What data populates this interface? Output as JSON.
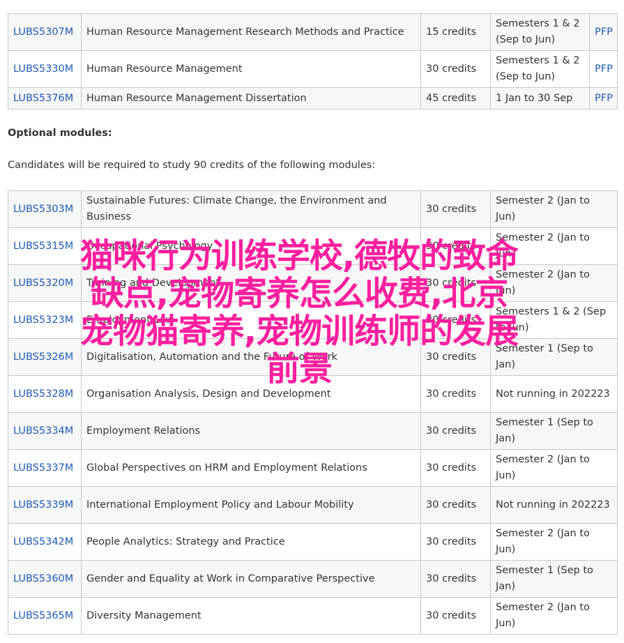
{
  "core_modules": [
    {
      "code": "LUBS5307M",
      "title": "Human Resource Management Research Methods and Practice",
      "credits": "15 credits",
      "semester": "Semesters 1 & 2 (Sep to Jun)",
      "pfp": "PFP"
    },
    {
      "code": "LUBS5330M",
      "title": "Human Resource Management",
      "credits": "30 credits",
      "semester": "Semesters 1 & 2 (Sep to Jun)",
      "pfp": "PFP"
    },
    {
      "code": "LUBS5376M",
      "title": "Human Resource Management Dissertation",
      "credits": "45 credits",
      "semester": "1 Jan to 30 Sep",
      "pfp": "PFP"
    }
  ],
  "optional": {
    "heading": "Optional modules:",
    "description": "Candidates will be required to study 90 credits of the following modules:"
  },
  "optional_modules": [
    {
      "code": "LUBS5303M",
      "title": "Sustainable Futures: Climate Change, the Environment and Business",
      "credits": "30 credits",
      "semester": "Semester 2 (Jan to Jun)"
    },
    {
      "code": "LUBS5315M",
      "title": "Occupational Psychology",
      "credits": "30 credits",
      "semester": "Semester 2 (Jan to Jun)"
    },
    {
      "code": "LUBS5320M",
      "title": "Training and Development",
      "credits": "30 credits",
      "semester": "Semester 2 (Jan to Jun)"
    },
    {
      "code": "LUBS5323M",
      "title": "Employment Law",
      "credits": "30 credits",
      "semester": "Semesters 1 & 2 (Sep to Jun)"
    },
    {
      "code": "LUBS5326M",
      "title": "Digitalisation, Automation and the Future of Work",
      "credits": "30 credits",
      "semester": "Semester 1 (Sep to Jan)"
    },
    {
      "code": "LUBS5328M",
      "title": "Organisation Analysis, Design and Development",
      "credits": "30 credits",
      "semester": "Not running in 202223"
    },
    {
      "code": "LUBS5334M",
      "title": "Employment Relations",
      "credits": "30 credits",
      "semester": "Semester 1 (Sep to Jan)"
    },
    {
      "code": "LUBS5337M",
      "title": "Global Perspectives on HRM and Employment Relations",
      "credits": "30 credits",
      "semester": "Semester 2 (Jan to Jun)"
    },
    {
      "code": "LUBS5339M",
      "title": "International Employment Policy and Labour Mobility",
      "credits": "30 credits",
      "semester": "Not running in 202223"
    },
    {
      "code": "LUBS5342M",
      "title": "People Analytics: Strategy and Practice",
      "credits": "30 credits",
      "semester": "Semester 2 (Jan to Jun)"
    },
    {
      "code": "LUBS5360M",
      "title": "Gender and Equality at Work in Comparative Perspective",
      "credits": "30 credits",
      "semester": "Semester 1 (Sep to Jan)"
    },
    {
      "code": "LUBS5365M",
      "title": "Diversity Management",
      "credits": "30 credits",
      "semester": "Semester 2 (Jan to Jun)"
    }
  ],
  "overlay": {
    "line1": "猫咪行为训练学校,德牧的致命",
    "line2": "缺点,宠物寄养怎么收费,北京",
    "line3": "宠物猫寄养,宠物训练师的发展",
    "line4": "前景"
  },
  "colors": {
    "link": "#1e5bb8",
    "overlay": "#ff1f9e",
    "border": "#c8c8c8"
  }
}
